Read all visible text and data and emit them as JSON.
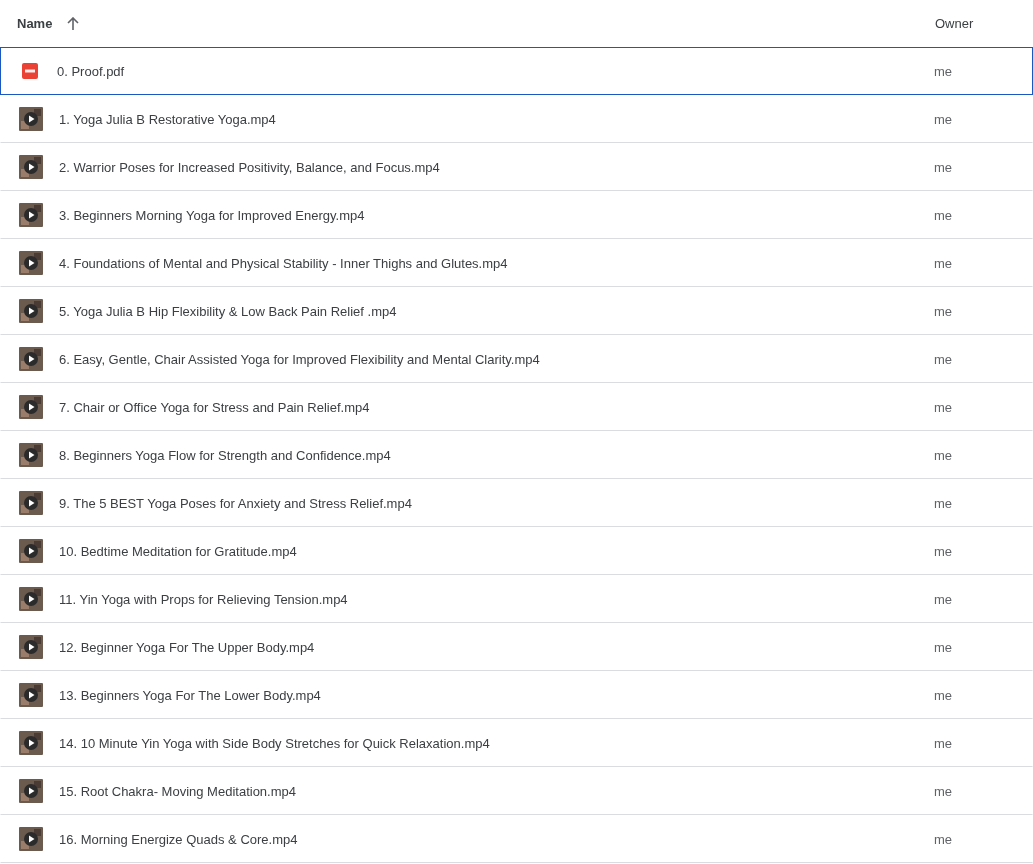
{
  "table": {
    "columns": [
      {
        "label": "Name",
        "sorted": true
      },
      {
        "label": "Owner",
        "sorted": false
      }
    ],
    "rows": [
      {
        "kind": "pdf",
        "name": "0. Proof.pdf",
        "owner": "me",
        "selected": true
      },
      {
        "kind": "video",
        "name": "1. Yoga Julia B Restorative Yoga.mp4",
        "owner": "me",
        "selected": false
      },
      {
        "kind": "video",
        "name": "2. Warrior Poses for Increased Positivity, Balance, and Focus.mp4",
        "owner": "me",
        "selected": false
      },
      {
        "kind": "video",
        "name": "3. Beginners Morning Yoga for Improved Energy.mp4",
        "owner": "me",
        "selected": false
      },
      {
        "kind": "video",
        "name": "4. Foundations of Mental and Physical Stability - Inner Thighs and Glutes.mp4",
        "owner": "me",
        "selected": false
      },
      {
        "kind": "video",
        "name": "5. Yoga Julia B Hip Flexibility & Low Back Pain Relief .mp4",
        "owner": "me",
        "selected": false
      },
      {
        "kind": "video",
        "name": "6. Easy, Gentle, Chair Assisted Yoga for Improved Flexibility and Mental Clarity.mp4",
        "owner": "me",
        "selected": false
      },
      {
        "kind": "video",
        "name": "7. Chair or Office Yoga for Stress and Pain Relief.mp4",
        "owner": "me",
        "selected": false
      },
      {
        "kind": "video",
        "name": "8. Beginners Yoga Flow for Strength and Confidence.mp4",
        "owner": "me",
        "selected": false
      },
      {
        "kind": "video",
        "name": "9. The 5 BEST Yoga Poses for Anxiety and Stress Relief.mp4",
        "owner": "me",
        "selected": false
      },
      {
        "kind": "video",
        "name": "10. Bedtime Meditation for Gratitude.mp4",
        "owner": "me",
        "selected": false
      },
      {
        "kind": "video",
        "name": "11. Yin Yoga with Props for Relieving Tension.mp4",
        "owner": "me",
        "selected": false
      },
      {
        "kind": "video",
        "name": "12. Beginner Yoga For The Upper Body.mp4",
        "owner": "me",
        "selected": false
      },
      {
        "kind": "video",
        "name": "13. Beginners Yoga For The Lower Body.mp4",
        "owner": "me",
        "selected": false
      },
      {
        "kind": "video",
        "name": "14. 10 Minute Yin Yoga with Side Body Stretches for Quick Relaxation.mp4",
        "owner": "me",
        "selected": false
      },
      {
        "kind": "video",
        "name": "15. Root Chakra- Moving Meditation.mp4",
        "owner": "me",
        "selected": false
      },
      {
        "kind": "video",
        "name": "16. Morning Energize Quads & Core.mp4",
        "owner": "me",
        "selected": false
      }
    ]
  }
}
